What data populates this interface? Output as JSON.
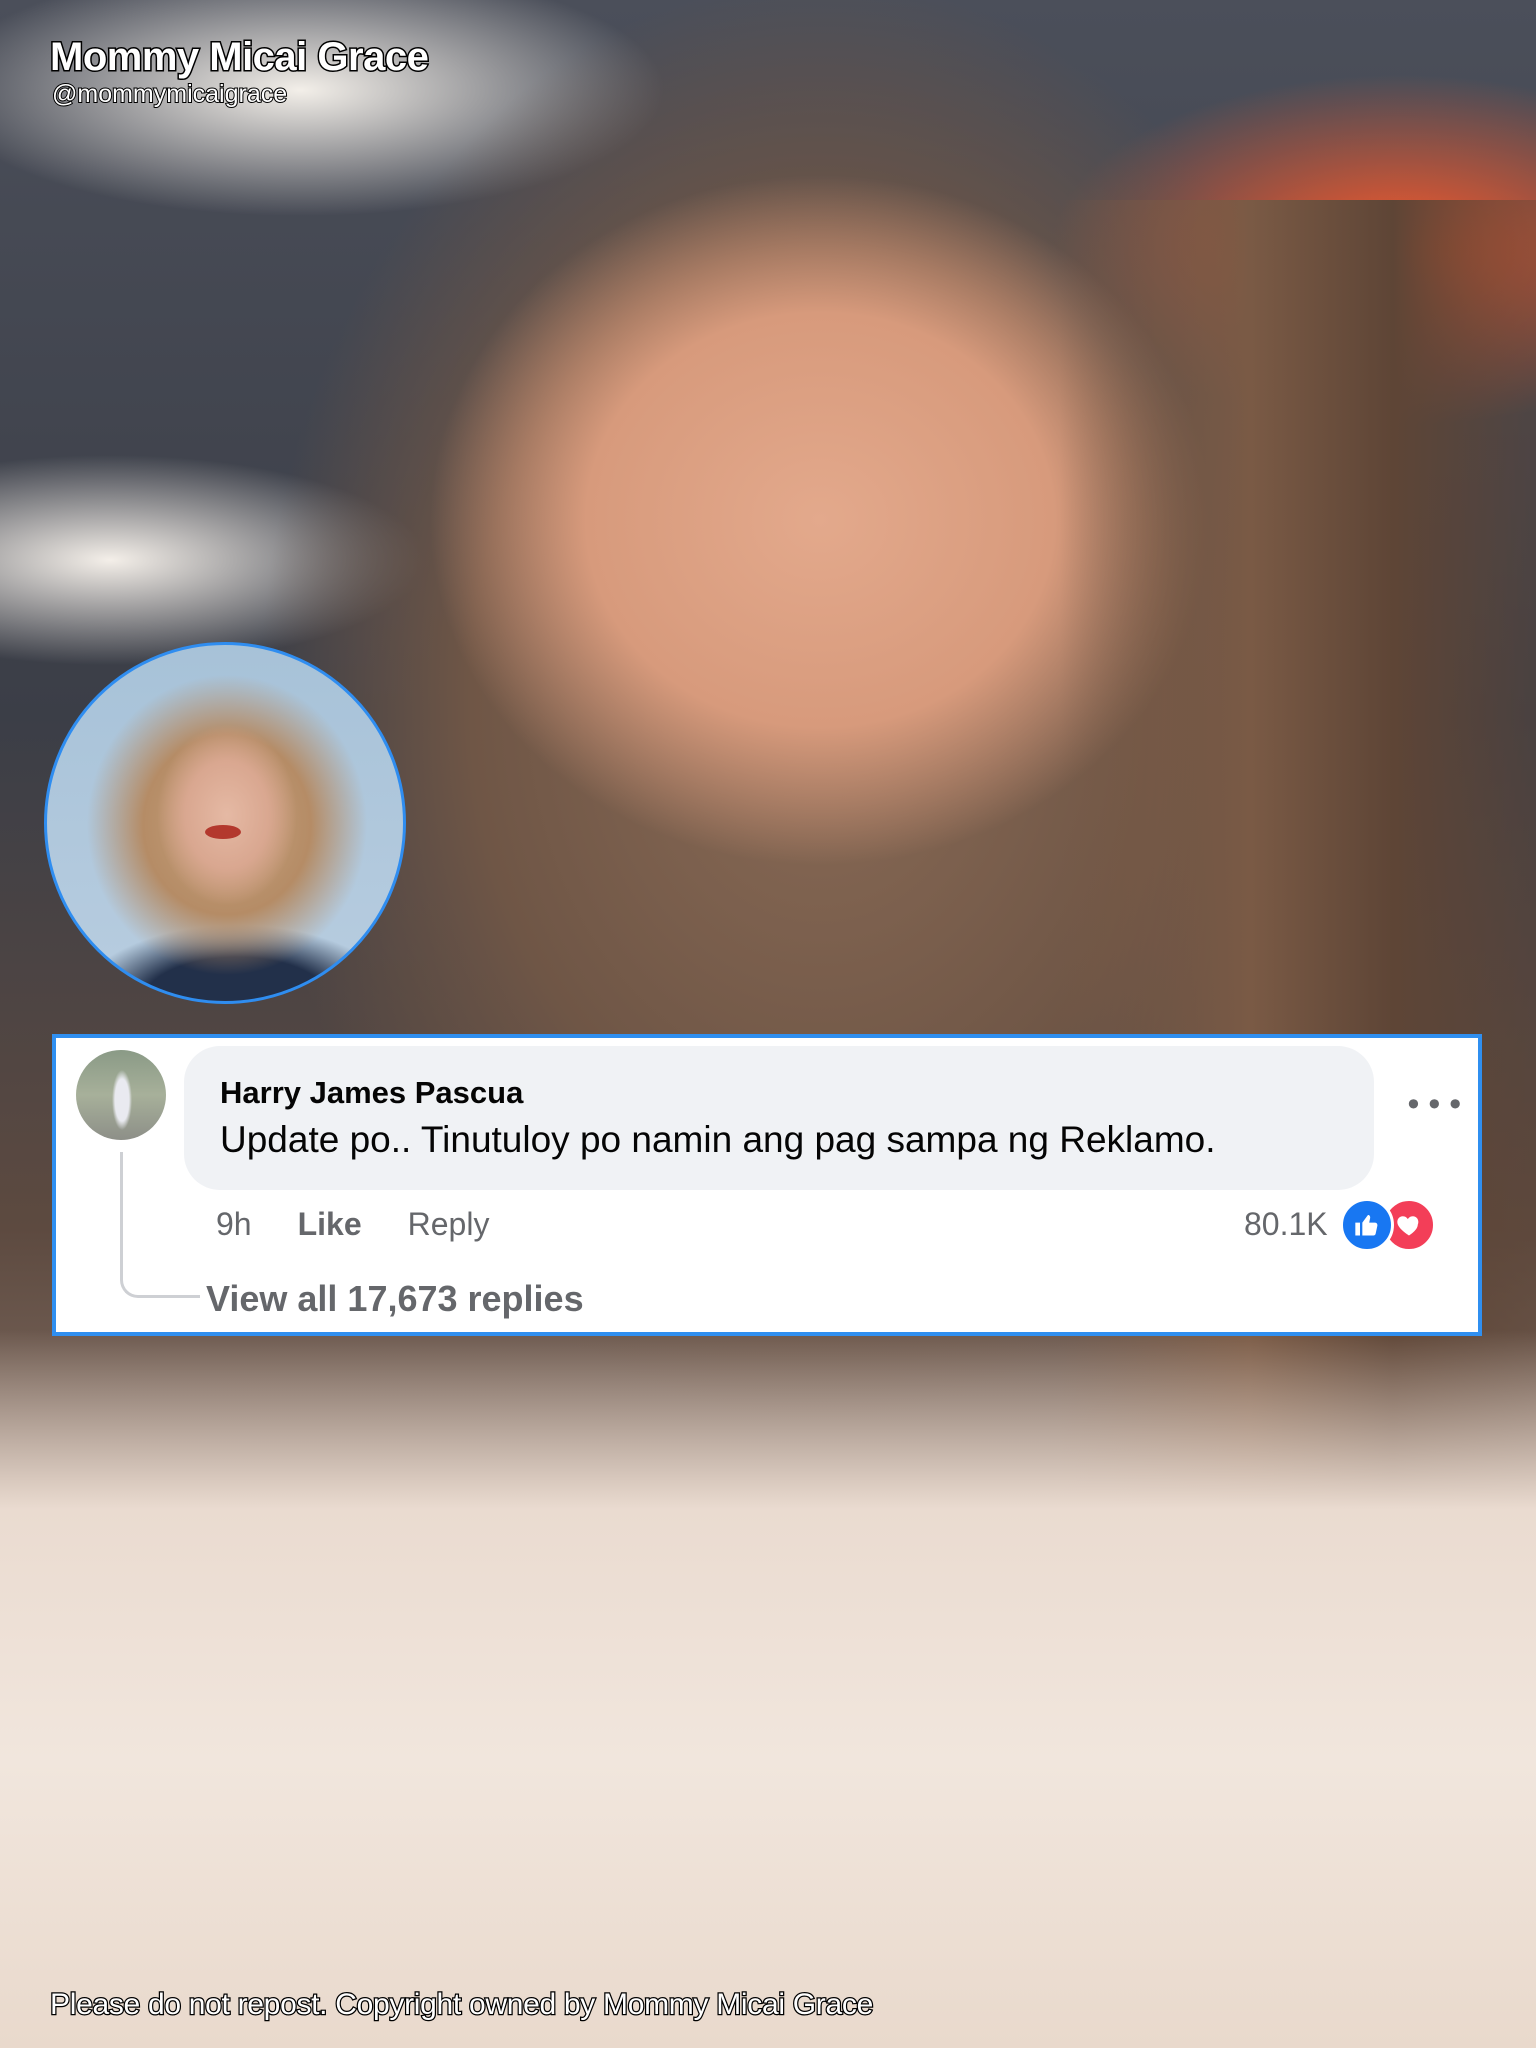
{
  "brand": {
    "name": "Mommy Micai Grace",
    "handle": "@mommymicaigrace"
  },
  "comment": {
    "author": "Harry James Pascua",
    "text": "Update po.. Tinutuloy po namin ang pag sampa ng Reklamo.",
    "time": "9h",
    "like_label": "Like",
    "reply_label": "Reply",
    "reaction_count": "80.1K",
    "reactions": [
      "like-icon",
      "love-icon"
    ],
    "view_replies": "View all 17,673 replies",
    "more_icon": "more-options-icon"
  },
  "footer": {
    "notice": "Please do not repost. Copyright owned by Mommy Micai Grace"
  },
  "colors": {
    "accent_border": "#2f8ff0",
    "like_blue": "#1877f2",
    "love_red": "#f33e58",
    "bubble_bg": "#f0f2f5",
    "meta_text": "#65676b"
  }
}
